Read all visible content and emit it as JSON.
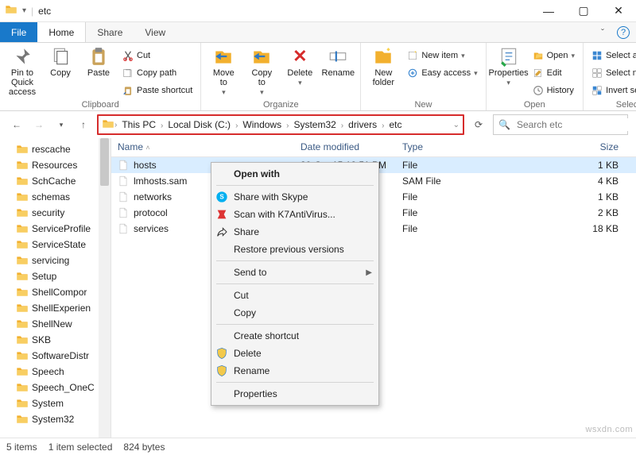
{
  "window": {
    "title": "etc",
    "min": "—",
    "max": "▢",
    "close": "✕"
  },
  "tabs": {
    "file": "File",
    "home": "Home",
    "share": "Share",
    "view": "View",
    "dropdown": "ˇ"
  },
  "ribbon": {
    "clipboard": {
      "label": "Clipboard",
      "pin": "Pin to Quick\naccess",
      "copy": "Copy",
      "paste": "Paste",
      "cut": "Cut",
      "copy_path": "Copy path",
      "paste_shortcut": "Paste shortcut"
    },
    "organize": {
      "label": "Organize",
      "move": "Move\nto",
      "copy_to": "Copy\nto",
      "delete": "Delete",
      "rename": "Rename"
    },
    "new": {
      "label": "New",
      "new_folder": "New\nfolder",
      "new_item": "New item",
      "easy_access": "Easy access"
    },
    "open": {
      "label": "Open",
      "properties": "Properties",
      "open": "Open",
      "edit": "Edit",
      "history": "History"
    },
    "select": {
      "label": "Select",
      "all": "Select all",
      "none": "Select none",
      "invert": "Invert selection"
    }
  },
  "breadcrumb": [
    "This PC",
    "Local Disk (C:)",
    "Windows",
    "System32",
    "drivers",
    "etc"
  ],
  "search_placeholder": "Search etc",
  "tree": [
    "rescache",
    "Resources",
    "SchCache",
    "schemas",
    "security",
    "ServiceProfile",
    "ServiceState",
    "servicing",
    "Setup",
    "ShellCompor",
    "ShellExperien",
    "ShellNew",
    "SKB",
    "SoftwareDistr",
    "Speech",
    "Speech_OneC",
    "System",
    "System32"
  ],
  "columns": {
    "name": "Name",
    "date": "Date modified",
    "type": "Type",
    "size": "Size"
  },
  "files": [
    {
      "name": "hosts",
      "date": "30-Oct-15 12:51 PM",
      "type": "File",
      "size": "1 KB",
      "selected": true
    },
    {
      "name": "lmhosts.sam",
      "date": "",
      "type": "SAM File",
      "size": "4 KB",
      "selected": false
    },
    {
      "name": "networks",
      "date": "",
      "type": "File",
      "size": "1 KB",
      "selected": false
    },
    {
      "name": "protocol",
      "date": "",
      "type": "File",
      "size": "2 KB",
      "selected": false
    },
    {
      "name": "services",
      "date": "",
      "type": "File",
      "size": "18 KB",
      "selected": false
    }
  ],
  "context": {
    "open_with": "Open with",
    "skype": "Share with Skype",
    "k7": "Scan with K7AntiVirus...",
    "share": "Share",
    "restore": "Restore previous versions",
    "send_to": "Send to",
    "cut": "Cut",
    "copy": "Copy",
    "shortcut": "Create shortcut",
    "delete": "Delete",
    "rename": "Rename",
    "properties": "Properties"
  },
  "status": {
    "items": "5 items",
    "selected": "1 item selected",
    "bytes": "824 bytes"
  },
  "watermark": "wsxdn.com"
}
